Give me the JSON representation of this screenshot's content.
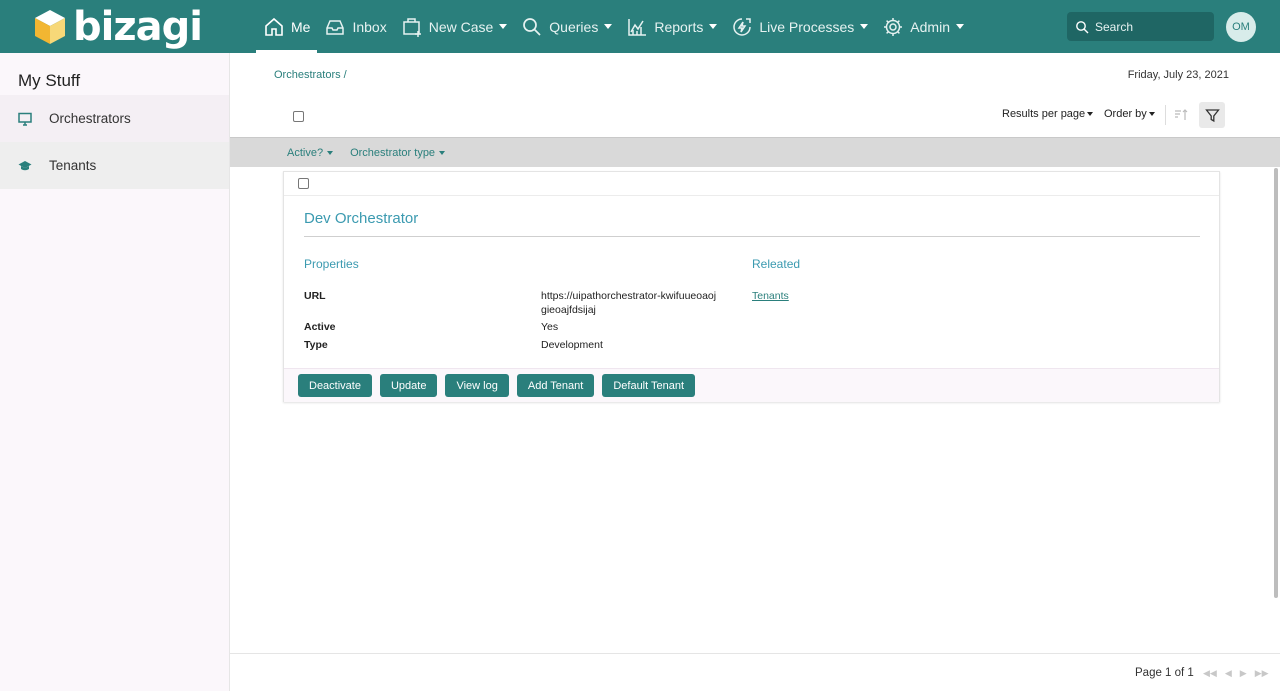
{
  "app": {
    "logo_text": "bizagi"
  },
  "nav": {
    "items": [
      {
        "label": "Me",
        "icon": "home-icon"
      },
      {
        "label": "Inbox",
        "icon": "inbox-icon"
      },
      {
        "label": "New Case",
        "icon": "new-case-icon"
      },
      {
        "label": "Queries",
        "icon": "search-icon"
      },
      {
        "label": "Reports",
        "icon": "chart-icon"
      },
      {
        "label": "Live Processes",
        "icon": "lightning-icon"
      },
      {
        "label": "Admin",
        "icon": "gear-icon"
      }
    ],
    "search_placeholder": "Search",
    "avatar_initials": "OM"
  },
  "sidebar": {
    "title": "My Stuff",
    "items": [
      {
        "label": "Orchestrators",
        "icon": "monitor-icon"
      },
      {
        "label": "Tenants",
        "icon": "graduation-cap-icon"
      }
    ]
  },
  "main": {
    "breadcrumb": "Orchestrators /",
    "date": "Friday, July 23, 2021",
    "results_per_page": "Results per page",
    "order_by": "Order by",
    "filters": [
      "Active?",
      "Orchestrator type"
    ]
  },
  "card": {
    "title": "Dev Orchestrator",
    "properties_header": "Properties",
    "related_header": "Releated",
    "properties": [
      {
        "label": "URL",
        "value": "https://uipathorchestrator-kwifuueoaojgieoajfdsijaj"
      },
      {
        "label": "Active",
        "value": "Yes"
      },
      {
        "label": "Type",
        "value": "Development"
      }
    ],
    "related_link": "Tenants",
    "actions": [
      "Deactivate",
      "Update",
      "View log",
      "Add Tenant",
      "Default Tenant"
    ]
  },
  "footer": {
    "page_info": "Page 1 of 1"
  },
  "colors": {
    "brand": "#2a7f7c",
    "accent_text": "#3b9ab0"
  }
}
